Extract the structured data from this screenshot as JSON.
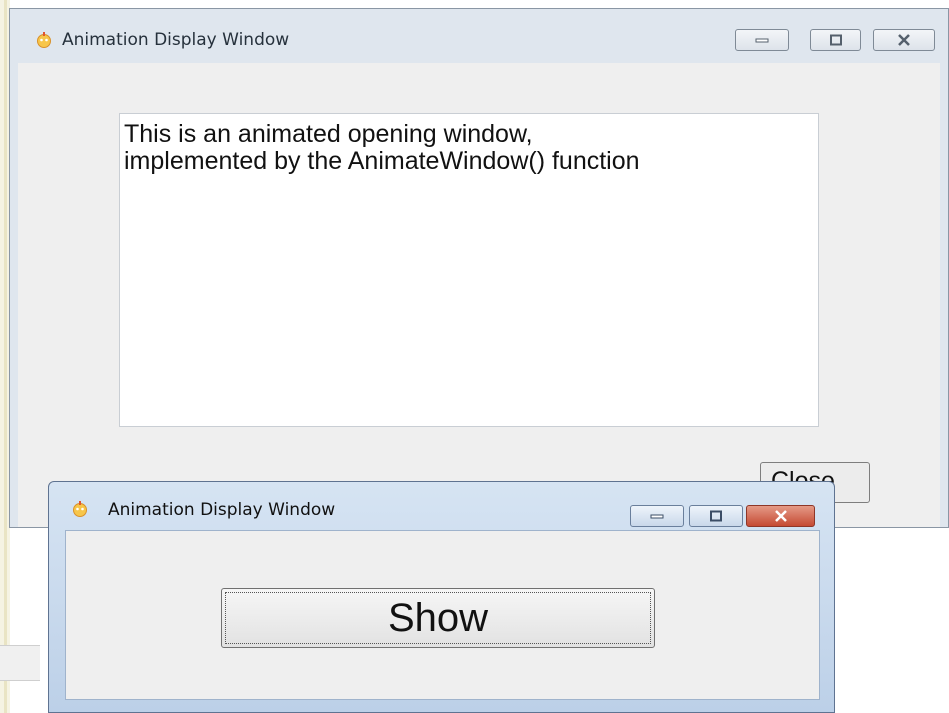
{
  "back_window": {
    "title": "Animation Display Window",
    "text_lines": [
      "This is an animated opening window,",
      "implemented by the AnimateWindow() function"
    ],
    "close_button_label": "Close"
  },
  "front_window": {
    "title": "Animation Display Window",
    "show_button_label": "Show"
  },
  "icons": {
    "app": "app-icon",
    "minimize": "minimize-icon",
    "maximize": "maximize-icon",
    "close": "close-icon"
  },
  "colors": {
    "close_button_active": "#c54a33",
    "front_frame": "#c7d8ec",
    "back_frame": "#dfe6ee"
  }
}
